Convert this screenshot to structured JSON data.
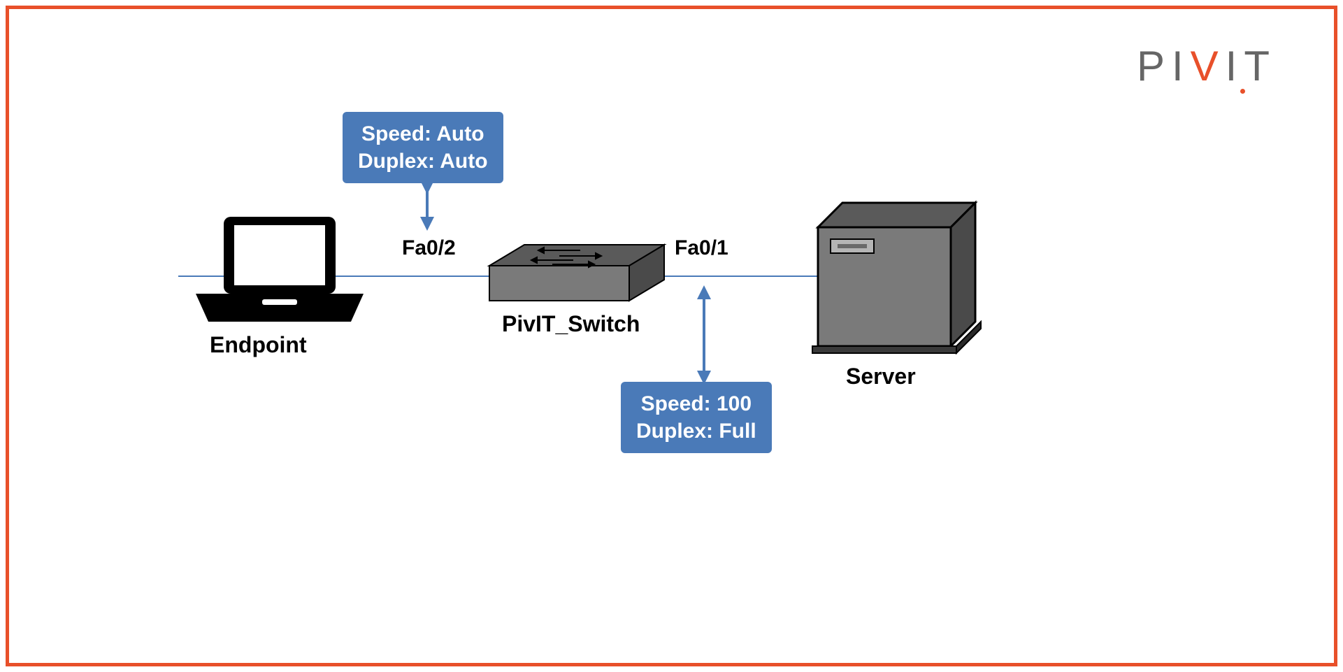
{
  "logo": {
    "text_p": "P",
    "text_i1": "I",
    "text_v": "V",
    "text_i2": "I",
    "text_t": "T"
  },
  "callout_top": {
    "line1": "Speed: Auto",
    "line2": "Duplex: Auto"
  },
  "callout_bottom": {
    "line1": "Speed: 100",
    "line2": "Duplex: Full"
  },
  "devices": {
    "endpoint": "Endpoint",
    "switch": "PivIT_Switch",
    "server": "Server"
  },
  "ports": {
    "left": "Fa0/2",
    "right": "Fa0/1"
  }
}
